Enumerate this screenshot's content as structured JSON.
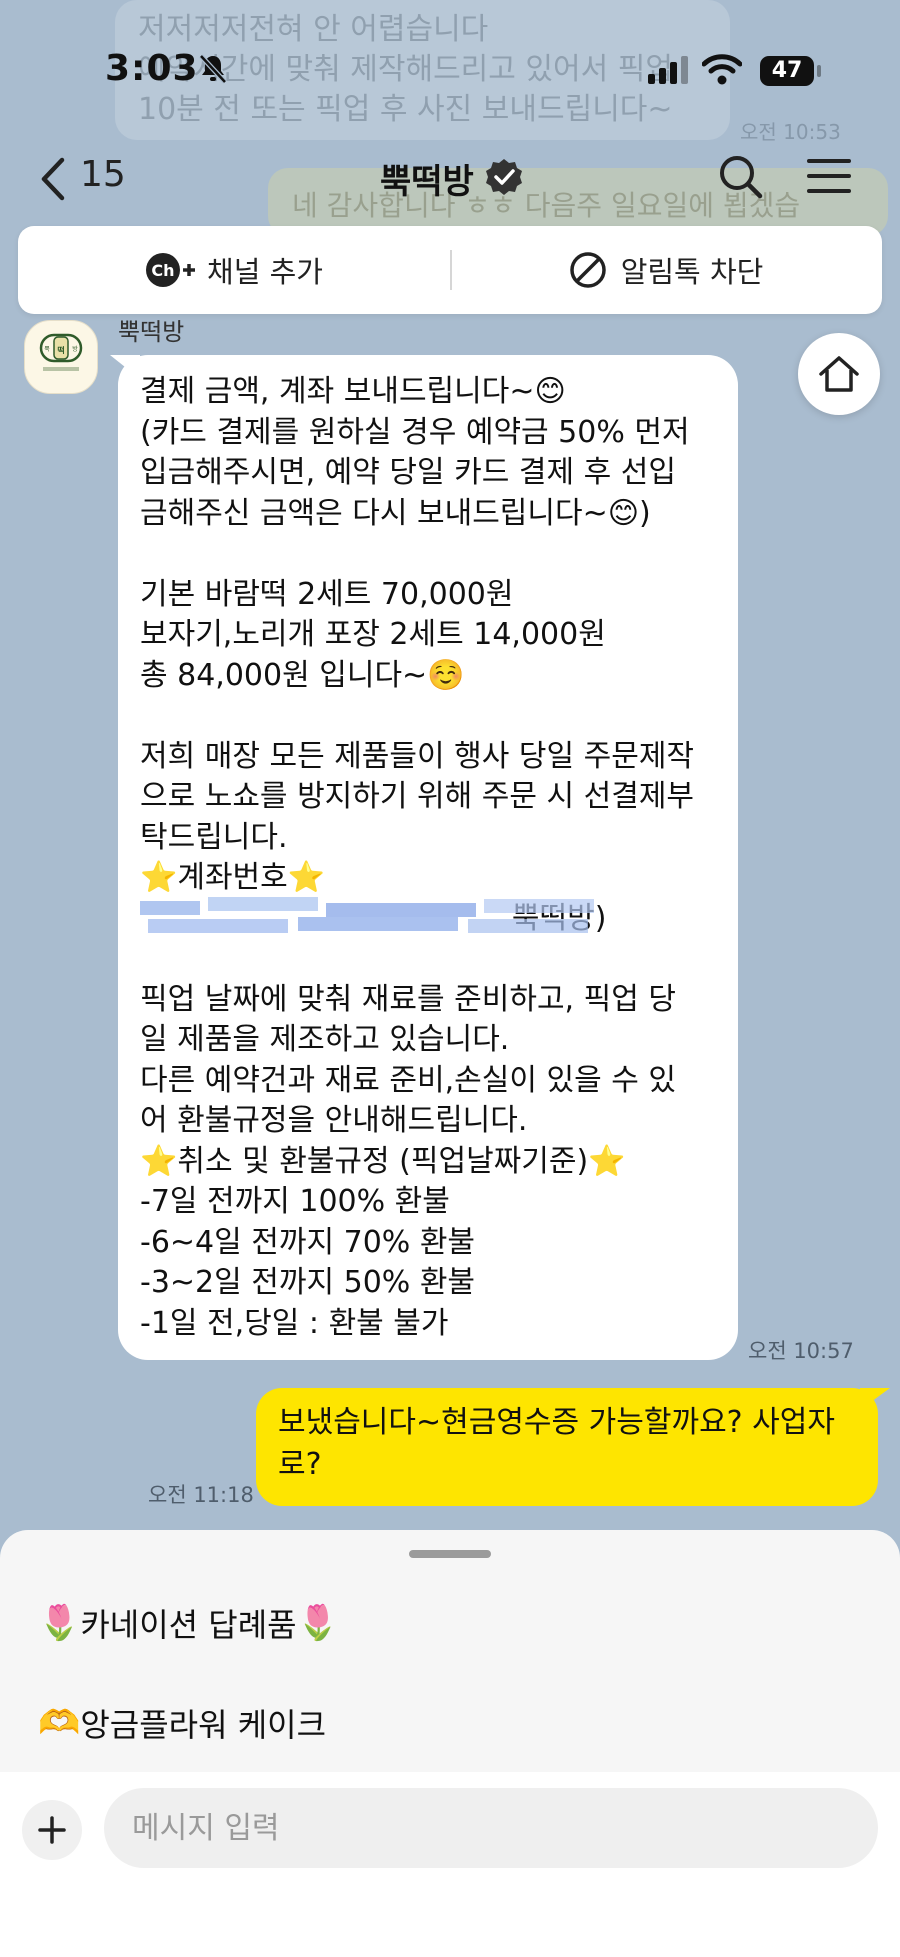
{
  "status_bar": {
    "time": "3:03",
    "battery": "47"
  },
  "background_preview": {
    "line1": "저저저저전혀 안 어렵습니다",
    "line2": "예약시간에 맞춰 제작해드리고 있어서 픽업",
    "line3": "10분 전 또는 픽업 후 사진 보내드립니다~",
    "time": "오전 10:53",
    "yellow_line": "네 감사합니다 ㅎㅎ 다음주 일요일에 뵙겠습"
  },
  "nav": {
    "unread_count": "15",
    "title": "뿍떡방"
  },
  "channel_bar": {
    "add_channel_label": "채널 추가",
    "block_label": "알림톡 차단"
  },
  "chat": {
    "sender": "뿍떡방",
    "avatar_text": "뿍떡방",
    "incoming_message": "결제 금액, 계좌 보내드립니다~😊\n(카드 결제를 원하실 경우 예약금 50% 먼저\n입금해주시면, 예약 당일 카드 결제 후 선입\n금해주신 금액은 다시 보내드립니다~😊)\n\n기본 바람떡 2세트 70,000원\n보자기,노리개 포장 2세트 14,000원\n총 84,000원 입니다~☺️\n\n저희 매장 모든 제품들이 행사 당일 주문제작\n으로 노쇼를 방지하기 위해 주문 시 선결제부\n탁드립니다.\n⭐계좌번호⭐\n                                       뿍떡방)\n\n픽업 날짜에 맞춰 재료를 준비하고, 픽업 당\n일 제품을 제조하고 있습니다.\n다른 예약건과 재료 준비,손실이 있을 수 있\n어 환불규정을 안내해드립니다.\n⭐취소 및 환불규정 (픽업날짜기준)⭐\n-7일 전까지 100% 환불\n-6~4일 전까지 70% 환불\n-3~2일 전까지 50% 환불\n-1일 전,당일 : 환불 불가",
    "incoming_time": "오전 10:57",
    "outgoing_message": "보냈습니다~현금영수증 가능할까요? 사업자\n로?",
    "outgoing_time": "오전 11:18"
  },
  "quick_replies": [
    {
      "label": "카네이션 답례품",
      "emoji": "🌷"
    },
    {
      "label": "앙금플라워 케이크",
      "emoji": "🫶"
    }
  ],
  "composer": {
    "placeholder": "메시지 입력"
  },
  "colors": {
    "chat_bg": "#a9bccf",
    "outgoing_bubble": "#fee500",
    "incoming_bubble": "#ffffff"
  },
  "icons": [
    "back-chevron-icon",
    "verified-badge-icon",
    "search-icon",
    "menu-icon",
    "channel-add-icon",
    "block-icon",
    "home-icon",
    "plus-icon"
  ]
}
